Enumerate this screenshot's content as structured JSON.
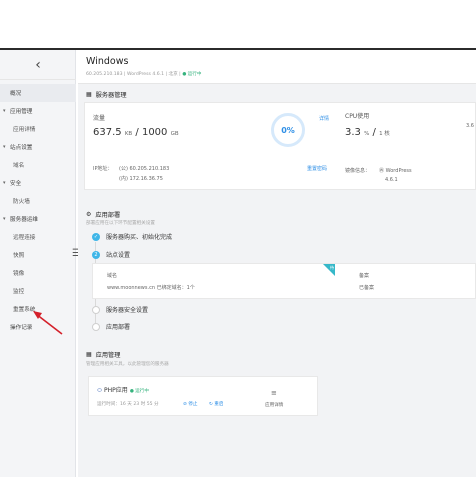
{
  "sidebar": {
    "collapse_glyph": "‹",
    "items": [
      {
        "label": "概况",
        "kind": "active"
      },
      {
        "label": "应用管理",
        "kind": "group"
      },
      {
        "label": "应用详情",
        "kind": "sub"
      },
      {
        "label": "站点设置",
        "kind": "group"
      },
      {
        "label": "域名",
        "kind": "sub"
      },
      {
        "label": "安全",
        "kind": "group"
      },
      {
        "label": "防火墙",
        "kind": "sub"
      },
      {
        "label": "服务器运维",
        "kind": "group"
      },
      {
        "label": "远程连接",
        "kind": "sub"
      },
      {
        "label": "快照",
        "kind": "sub"
      },
      {
        "label": "镜像",
        "kind": "sub"
      },
      {
        "label": "监控",
        "kind": "sub"
      },
      {
        "label": "重置系统",
        "kind": "sub"
      },
      {
        "label": "操作记录",
        "kind": "plain"
      }
    ],
    "splitter_glyph": "☰"
  },
  "header": {
    "title": "Windows",
    "subtitle_prefix": "60.205.210.183 | WordPress 4.6.1 | 北京 |",
    "status": "● 运行中"
  },
  "server_mgmt": {
    "title": "服务器管理",
    "traffic_label": "流量",
    "traffic_used": "637.5",
    "traffic_used_unit": "KB",
    "traffic_total": "1000",
    "traffic_total_unit": "GB",
    "ring_value": "0%",
    "detail_link": "详情",
    "cpu_label": "CPU使用",
    "cpu_value": "3.3",
    "cpu_unit": "%",
    "cpu_cores": "1 核",
    "right_edge_value": "3.6",
    "ip_label": "IP地址：",
    "ip_public": "(公) 60.205.210.183",
    "ip_private": "(内) 172.16.36.75",
    "reset_pwd_link": "重置密码",
    "image_label": "镜像信息：",
    "image_name": "WordPress",
    "image_version": "4.6.1"
  },
  "deploy": {
    "title": "应用部署",
    "desc": "部署应用在以下环节配置相关设置",
    "steps": [
      {
        "label": "服务器购买、初始化完成",
        "state": "done",
        "mark": "✓"
      },
      {
        "label": "站点设置",
        "state": "cur",
        "mark": "2"
      },
      {
        "label": "服务器安全设置",
        "state": "todo",
        "mark": ""
      },
      {
        "label": "应用部署",
        "state": "todo",
        "mark": ""
      }
    ],
    "site_card": {
      "domain_label": "域名",
      "domain_value": "www.moonnews.cn 已绑定域名：1个",
      "backup_label": "备案",
      "backup_value": "已备案",
      "flag_text": "待"
    }
  },
  "app_mgmt": {
    "title": "应用管理",
    "desc": "管理应用相关工具，以此管理您的服务器",
    "app_name": "PHP应用",
    "app_status": "● 运行中",
    "runtime": "运行时间：16 天 23 时 55 分",
    "stop_link": "⊘ 停止",
    "restart_link": "↻ 重启",
    "detail_icon": "≡",
    "detail_label": "应用详情"
  },
  "colors": {
    "accent": "#2f8fe6",
    "step": "#3fb6e8",
    "running": "#36b37e",
    "flag": "#36b8c9",
    "arrow": "#d4202a"
  }
}
